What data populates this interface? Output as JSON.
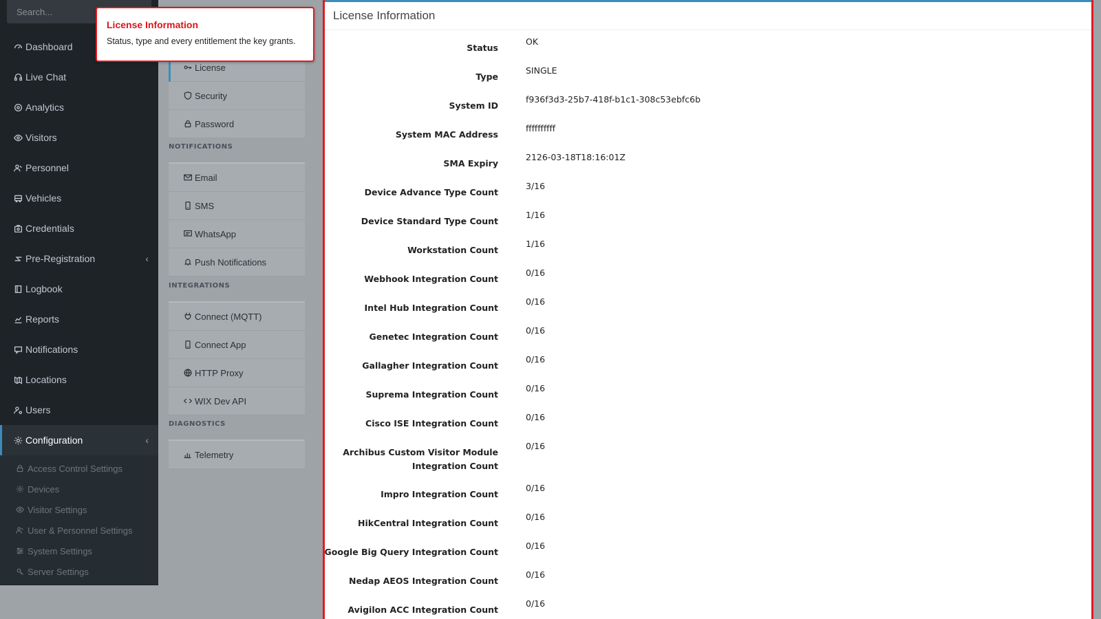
{
  "sidebar": {
    "search_placeholder": "Search...",
    "items": [
      {
        "label": "Dashboard",
        "icon": "dashboard-icon"
      },
      {
        "label": "Live Chat",
        "icon": "headset-icon"
      },
      {
        "label": "Analytics",
        "icon": "target-icon"
      },
      {
        "label": "Visitors",
        "icon": "eye-icon"
      },
      {
        "label": "Personnel",
        "icon": "users-icon"
      },
      {
        "label": "Vehicles",
        "icon": "bus-icon"
      },
      {
        "label": "Credentials",
        "icon": "id-badge-icon"
      },
      {
        "label": "Pre-Registration",
        "icon": "arrows-icon"
      },
      {
        "label": "Logbook",
        "icon": "book-icon"
      },
      {
        "label": "Reports",
        "icon": "chart-icon"
      },
      {
        "label": "Notifications",
        "icon": "chat-icon"
      },
      {
        "label": "Locations",
        "icon": "map-icon"
      },
      {
        "label": "Users",
        "icon": "user-cog-icon"
      },
      {
        "label": "Configuration",
        "icon": "gear-icon"
      }
    ],
    "sub_items": [
      {
        "label": "Access Control Settings",
        "icon": "lock-icon"
      },
      {
        "label": "Devices",
        "icon": "gear-icon"
      },
      {
        "label": "Visitor Settings",
        "icon": "eye-icon"
      },
      {
        "label": "User & Personnel Settings",
        "icon": "users-icon"
      },
      {
        "label": "System Settings",
        "icon": "sliders-icon"
      },
      {
        "label": "Server Settings",
        "icon": "server-icon"
      }
    ]
  },
  "settings_menu": {
    "sections": [
      "NOTIFICATIONS",
      "INTEGRATIONS",
      "DIAGNOSTICS"
    ],
    "top_items": [
      {
        "label": "License",
        "icon": "key-icon"
      },
      {
        "label": "Security",
        "icon": "shield-icon"
      },
      {
        "label": "Password",
        "icon": "lock-icon"
      }
    ],
    "notification_items": [
      {
        "label": "Email",
        "icon": "envelope-icon"
      },
      {
        "label": "SMS",
        "icon": "mobile-icon"
      },
      {
        "label": "WhatsApp",
        "icon": "message-icon"
      },
      {
        "label": "Push Notifications",
        "icon": "bell-icon"
      }
    ],
    "integration_items": [
      {
        "label": "Connect (MQTT)",
        "icon": "plug-icon"
      },
      {
        "label": "Connect App",
        "icon": "mobile-icon"
      },
      {
        "label": "HTTP Proxy",
        "icon": "globe-icon"
      },
      {
        "label": "WIX Dev API",
        "icon": "code-icon"
      }
    ],
    "diagnostic_items": [
      {
        "label": "Telemetry",
        "icon": "bar-chart-icon"
      }
    ]
  },
  "tooltip": {
    "title": "License Information",
    "text": "Status, type and every entitlement the key grants."
  },
  "card": {
    "title": "License Information",
    "rows": [
      {
        "label": "Status",
        "value": "OK"
      },
      {
        "label": "Type",
        "value": "SINGLE"
      },
      {
        "label": "System ID",
        "value": "f936f3d3-25b7-418f-b1c1-308c53ebfc6b"
      },
      {
        "label": "System MAC Address",
        "value": "ffffffffff"
      },
      {
        "label": "SMA Expiry",
        "value": "2126-03-18T18:16:01Z"
      },
      {
        "label": "Device Advance Type Count",
        "value": "3/16"
      },
      {
        "label": "Device Standard Type Count",
        "value": "1/16"
      },
      {
        "label": "Workstation Count",
        "value": "1/16"
      },
      {
        "label": "Webhook Integration Count",
        "value": "0/16"
      },
      {
        "label": "Intel Hub Integration Count",
        "value": "0/16"
      },
      {
        "label": "Genetec Integration Count",
        "value": "0/16"
      },
      {
        "label": "Gallagher Integration Count",
        "value": "0/16"
      },
      {
        "label": "Suprema Integration Count",
        "value": "0/16"
      },
      {
        "label": "Cisco ISE Integration Count",
        "value": "0/16"
      },
      {
        "label": "Archibus Custom Visitor Module Integration Count",
        "value": "0/16"
      },
      {
        "label": "Impro Integration Count",
        "value": "0/16"
      },
      {
        "label": "HikCentral Integration Count",
        "value": "0/16"
      },
      {
        "label": "Google Big Query Integration Count",
        "value": "0/16"
      },
      {
        "label": "Nedap AEOS Integration Count",
        "value": "0/16"
      },
      {
        "label": "Avigilon ACC Integration Count",
        "value": "0/16"
      }
    ]
  },
  "colors": {
    "sidebar_bg": "#1d2327",
    "accent": "#3c8dbc",
    "highlight_border": "#e3191f"
  }
}
